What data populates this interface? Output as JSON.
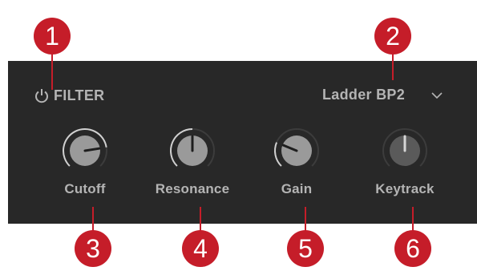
{
  "filter": {
    "power_icon": "power-icon",
    "label": "FILTER",
    "type_value": "Ladder BP2",
    "dropdown_icon": "chevron-down-icon"
  },
  "knobs": [
    {
      "label": "Cutoff",
      "level": 0.8,
      "active": true
    },
    {
      "label": "Resonance",
      "level": 0.5,
      "active": true
    },
    {
      "label": "Gain",
      "level": 0.25,
      "active": true
    },
    {
      "label": "Keytrack",
      "level": 0.5,
      "active": false
    }
  ],
  "callouts": [
    "1",
    "2",
    "3",
    "4",
    "5",
    "6"
  ],
  "colors": {
    "panel": "#282828",
    "text": "#b4b4b4",
    "callout": "#c51d29",
    "knob_face": "#9a9a9a",
    "knob_face_inactive": "#5a5a5a"
  }
}
